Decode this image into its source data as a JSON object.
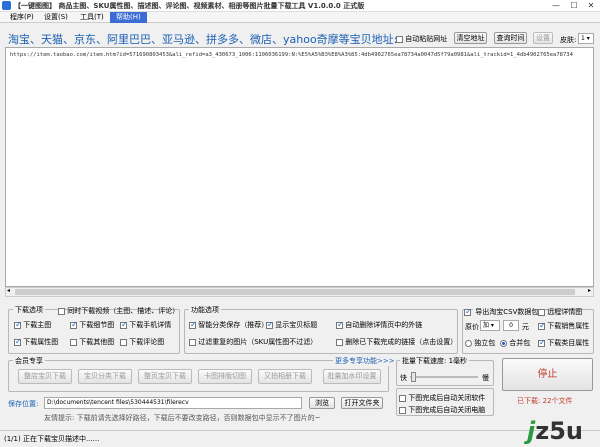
{
  "window": {
    "title": "【一键图图】 商品主图、SKU属性图、描述图、评论图、视频素材、相册等图片批量下载工具 V1.0.0.0 正式版",
    "minimize": "—",
    "maximize": "☐",
    "close": "✕"
  },
  "menu": [
    {
      "label": "程序(P)"
    },
    {
      "label": "设置(S)"
    },
    {
      "label": "工具(T)"
    },
    {
      "label": "帮助(H)"
    }
  ],
  "top": {
    "sites_label": "淘宝、天猫、京东、阿里巴巴、亚马逊、拼多多、微店、yahoo奇摩等宝贝地址:",
    "auto_paste_label": "自动粘贴网址",
    "clear_button": "清空地址",
    "query_time_button": "查询时间",
    "settings_button": "设置",
    "skin_label": "皮肤:",
    "skin_value": "1"
  },
  "url_text": "https://item.taobao.com/item.htm?id=571690803453&ali_refid=a3_430673_1006:1106036199:N:%E5%A5%B3%E8%A3%85:4db4902765ea78734a0047d5f79a0981&ali_trackid=1_4db4902765ea78734",
  "download_options": {
    "legend": "下载选项",
    "sync_video_label": "同时下载视频（主图、描述、评论）",
    "items": [
      {
        "label": "下载主图",
        "checked": true
      },
      {
        "label": "下载细节图",
        "checked": true
      },
      {
        "label": "下载手机详情",
        "checked": true
      },
      {
        "label": "下载属性图",
        "checked": true
      },
      {
        "label": "下载其他图",
        "checked": false
      },
      {
        "label": "下载评论图",
        "checked": false
      }
    ]
  },
  "function_options": {
    "legend": "功能选项",
    "items": [
      {
        "label": "智能分类保存（推荐）",
        "checked": true
      },
      {
        "label": "显示宝贝标题",
        "checked": true
      },
      {
        "label": "自动删除详情页中的外链",
        "checked": true
      },
      {
        "label": "过滤重复的图片（SKU属性图不过滤）",
        "checked": false
      },
      {
        "label": "删除已下载完成的链接（点击设置）",
        "checked": false
      }
    ]
  },
  "csv_options": {
    "export_csv_label": "导出淘宝CSV数据包",
    "remote_detail_label": "远程详情图",
    "price_label": "原价",
    "price_op": "加",
    "price_value": "0",
    "price_unit": "元",
    "download_sale_attr_label": "下载销售属性",
    "single_pack_label": "独立包",
    "merge_pack_label": "合并包",
    "download_class_attr_label": "下载类目属性"
  },
  "member": {
    "legend": "会员专享",
    "more_link": "更多专享功能>>>",
    "buttons": [
      "整店宝贝下载",
      "宝贝分类下载",
      "整页宝贝下载",
      "卡图排版切图",
      "又拍相册下载",
      "批量加水印设置"
    ]
  },
  "speed": {
    "legend": "批量下载速度: 1毫秒",
    "slow": "快",
    "fast": "慢",
    "value_fraction": 0.02
  },
  "after_options": [
    {
      "label": "下图完成后自动关闭软件",
      "checked": false
    },
    {
      "label": "下图完成后自动关闭电脑",
      "checked": false
    }
  ],
  "stop_button": "停止",
  "save": {
    "label": "保存位置:",
    "path": "D:\\documents\\tencent files\\530444531\\filerecv",
    "browse_button": "浏览",
    "open_folder_button": "打开文件夹"
  },
  "tip": "友情提示: 下载前请先选择好路径，下载后不要改变路径，否则数据包中显示不了图片的~",
  "downloaded": "已下载: 22个文件",
  "status": "(1/1) 正在下载宝贝描述中......",
  "logo": {
    "j": "j",
    "rest": "z5u"
  },
  "colors": {
    "accent": "#1a5fb4",
    "stop_text": "#c0392b",
    "downloaded_text": "#c0392b"
  }
}
